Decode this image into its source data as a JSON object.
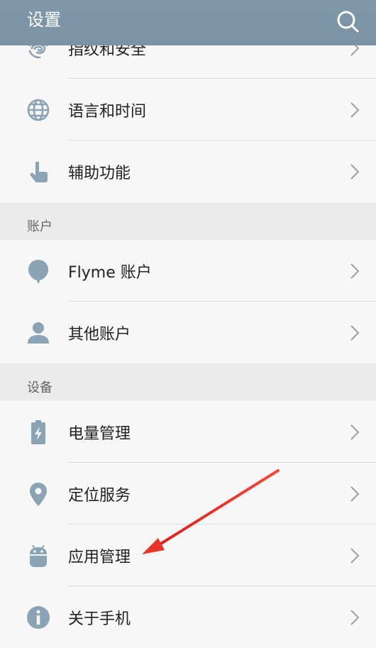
{
  "header": {
    "title": "设置",
    "search_icon": "search-icon"
  },
  "items_top": [
    {
      "label": "指纹和安全",
      "icon": "fingerprint-icon"
    },
    {
      "label": "语言和时间",
      "icon": "globe-icon"
    },
    {
      "label": "辅助功能",
      "icon": "hand-pointer-icon"
    }
  ],
  "section_account": {
    "title": "账户"
  },
  "items_account": [
    {
      "label": "Flyme 账户",
      "icon": "balloon-icon"
    },
    {
      "label": "其他账户",
      "icon": "person-icon"
    }
  ],
  "section_device": {
    "title": "设备"
  },
  "items_device": [
    {
      "label": "电量管理",
      "icon": "battery-icon"
    },
    {
      "label": "定位服务",
      "icon": "location-pin-icon"
    },
    {
      "label": "应用管理",
      "icon": "android-icon"
    },
    {
      "label": "关于手机",
      "icon": "info-icon"
    }
  ],
  "colors": {
    "header": "#7f97a8",
    "icon": "#8aa3b5",
    "annotation_arrow": "#e8352a"
  }
}
